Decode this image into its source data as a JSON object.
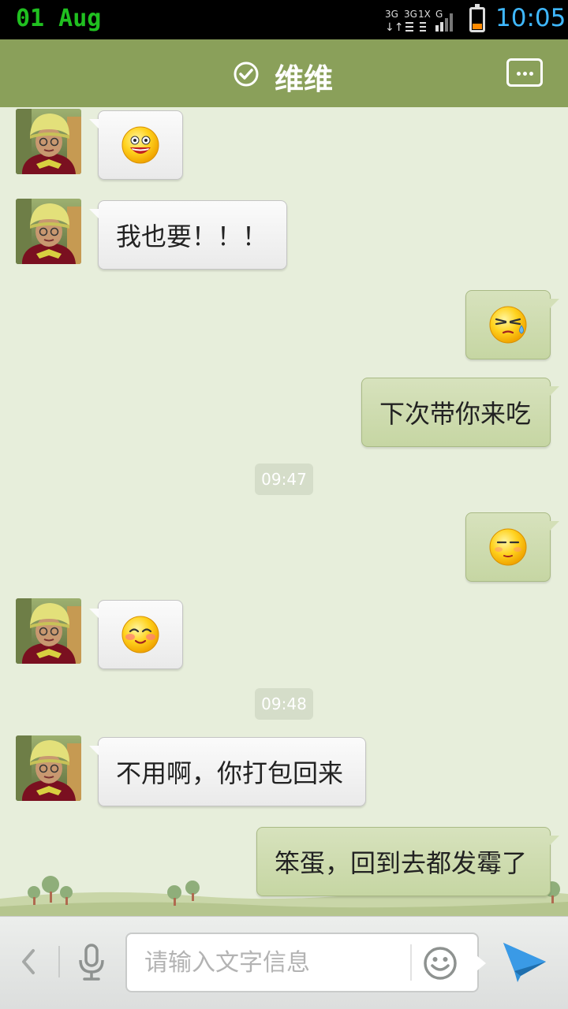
{
  "status_bar": {
    "date": "01 Aug",
    "network": [
      "3G",
      "3G",
      "1X",
      "G"
    ],
    "time": "10:05"
  },
  "header": {
    "title": "维维",
    "verified_icon": "check-circle-icon",
    "more_icon": "more-icon"
  },
  "messages": [
    {
      "side": "in",
      "type": "emoji",
      "emoji": "grinning-face"
    },
    {
      "side": "in",
      "type": "text",
      "text": "我也要！！！"
    },
    {
      "side": "out",
      "type": "emoji",
      "emoji": "sweat-face"
    },
    {
      "side": "out",
      "type": "text",
      "text": "下次带你来吃"
    },
    {
      "type": "time",
      "text": "09:47"
    },
    {
      "side": "out",
      "type": "emoji",
      "emoji": "relieved-face"
    },
    {
      "side": "in",
      "type": "emoji",
      "emoji": "blushing-face"
    },
    {
      "type": "time",
      "text": "09:48"
    },
    {
      "side": "in",
      "type": "text",
      "text": "不用啊，你打包回来"
    },
    {
      "side": "out",
      "type": "text",
      "text": "笨蛋，回到去都发霉了"
    }
  ],
  "input": {
    "placeholder": "请输入文字信息",
    "back_icon": "chevron-left-icon",
    "mic_icon": "microphone-icon",
    "emoji_icon": "smiley-icon",
    "send_icon": "send-icon"
  },
  "colors": {
    "header": "#8aa05a",
    "background": "#e7eedb",
    "outgoing_bubble": "#cbd9a9",
    "incoming_bubble": "#f5f5f5",
    "send_button": "#2f8fd8",
    "status_date": "#20c020",
    "status_time": "#3fb8ff"
  }
}
